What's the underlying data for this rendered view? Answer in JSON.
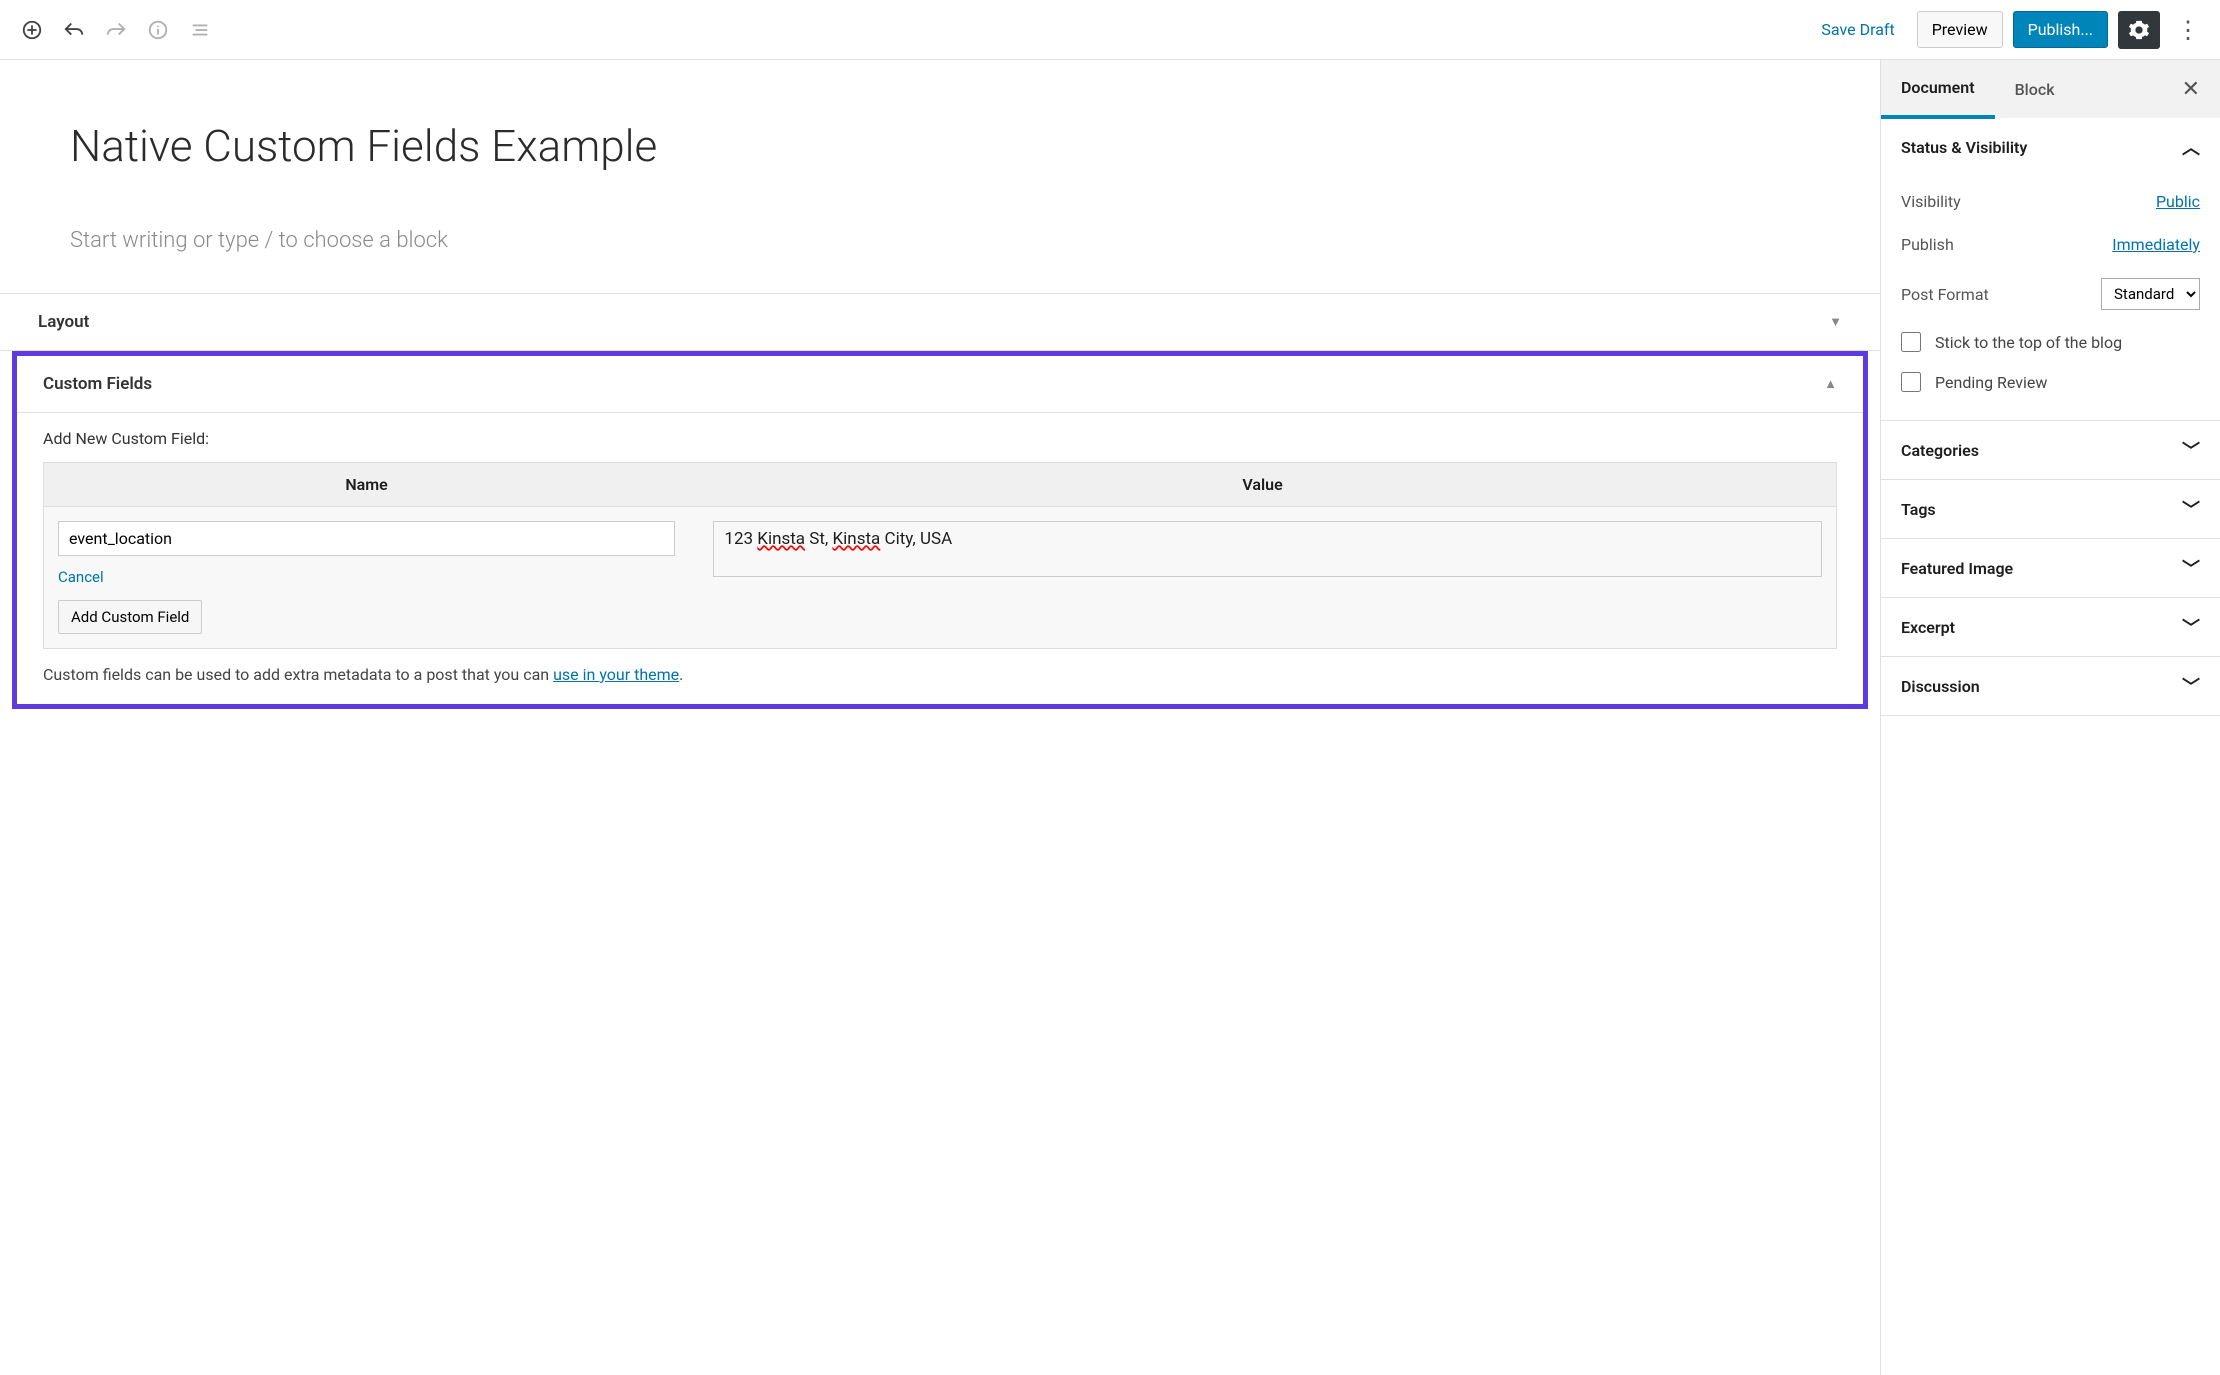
{
  "toolbar": {
    "save_draft": "Save Draft",
    "preview": "Preview",
    "publish": "Publish..."
  },
  "editor": {
    "title": "Native Custom Fields Example",
    "block_placeholder": "Start writing or type / to choose a block"
  },
  "layout_panel": {
    "title": "Layout"
  },
  "custom_fields": {
    "title": "Custom Fields",
    "add_heading": "Add New Custom Field:",
    "name_header": "Name",
    "value_header": "Value",
    "name_value": "event_location",
    "value_prefix": "123 ",
    "value_err1": "Kinsta",
    "value_mid": " St, ",
    "value_err2": "Kinsta",
    "value_suffix": " City, USA",
    "cancel": "Cancel",
    "add_button": "Add Custom Field",
    "footnote_text": "Custom fields can be used to add extra metadata to a post that you can ",
    "footnote_link": "use in your theme",
    "footnote_end": "."
  },
  "sidebar": {
    "tabs": {
      "document": "Document",
      "block": "Block"
    },
    "status": {
      "title": "Status & Visibility",
      "visibility_label": "Visibility",
      "visibility_value": "Public",
      "publish_label": "Publish",
      "publish_value": "Immediately",
      "format_label": "Post Format",
      "format_value": "Standard",
      "stick_label": "Stick to the top of the blog",
      "pending_label": "Pending Review"
    },
    "sections": {
      "categories": "Categories",
      "tags": "Tags",
      "featured_image": "Featured Image",
      "excerpt": "Excerpt",
      "discussion": "Discussion"
    }
  }
}
